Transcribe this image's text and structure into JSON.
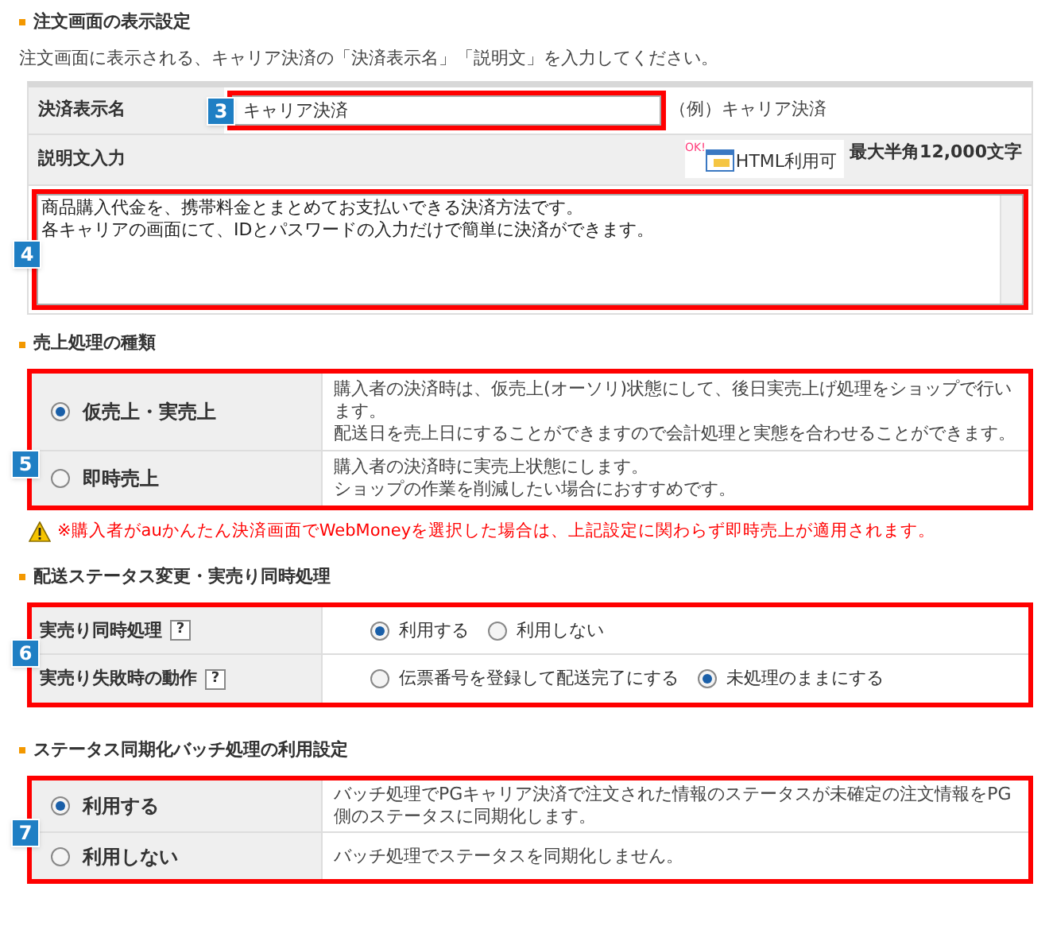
{
  "display_settings": {
    "title": "注文画面の表示設定",
    "description": "注文画面に表示される、キャリア決済の「決済表示名」「説明文」を入力してください。",
    "name_field": {
      "label": "決済表示名",
      "value": "キャリア決済",
      "example": "（例）キャリア決済",
      "annotation": "3"
    },
    "description_field": {
      "label": "説明文入力",
      "ok_badge": "OK!",
      "html_badge": "HTML利用可",
      "limit": "最大半角12,000文字",
      "lines": [
        "商品購入代金を、携帯料金とまとめてお支払いできる決済方法です。",
        "各キャリアの画面にて、IDとパスワードの入力だけで簡単に決済ができます。"
      ],
      "annotation": "4"
    }
  },
  "sales_type": {
    "title": "売上処理の種類",
    "annotation": "5",
    "options": [
      {
        "label": "仮売上・実売上",
        "selected": true,
        "lines": [
          "購入者の決済時は、仮売上(オーソリ)状態にして、後日実売上げ処理をショップで行います。",
          "配送日を売上日にすることができますので会計処理と実態を合わせることができます。"
        ]
      },
      {
        "label": "即時売上",
        "selected": false,
        "lines": [
          "購入者の決済時に実売上状態にします。",
          "ショップの作業を削減したい場合におすすめです。"
        ]
      }
    ],
    "warning": "※購入者がauかんたん決済画面でWebMoneyを選択した場合は、上記設定に関わらず即時売上が適用されます。"
  },
  "shipping_sync": {
    "title": "配送ステータス変更・実売り同時処理",
    "annotation": "6",
    "rows": [
      {
        "label": "実売り同時処理",
        "help": "?",
        "options": [
          {
            "label": "利用する",
            "selected": true
          },
          {
            "label": "利用しない",
            "selected": false
          }
        ]
      },
      {
        "label": "実売り失敗時の動作",
        "help": "?",
        "options": [
          {
            "label": "伝票番号を登録して配送完了にする",
            "selected": false
          },
          {
            "label": "未処理のままにする",
            "selected": true
          }
        ]
      }
    ]
  },
  "batch_sync": {
    "title": "ステータス同期化バッチ処理の利用設定",
    "annotation": "7",
    "options": [
      {
        "label": "利用する",
        "selected": true,
        "lines": [
          "バッチ処理でPGキャリア決済で注文された情報のステータスが未確定の注文情報をPG側のステータスに同期化します。"
        ]
      },
      {
        "label": "利用しない",
        "selected": false,
        "lines": [
          "バッチ処理でステータスを同期化しません。"
        ]
      }
    ]
  }
}
